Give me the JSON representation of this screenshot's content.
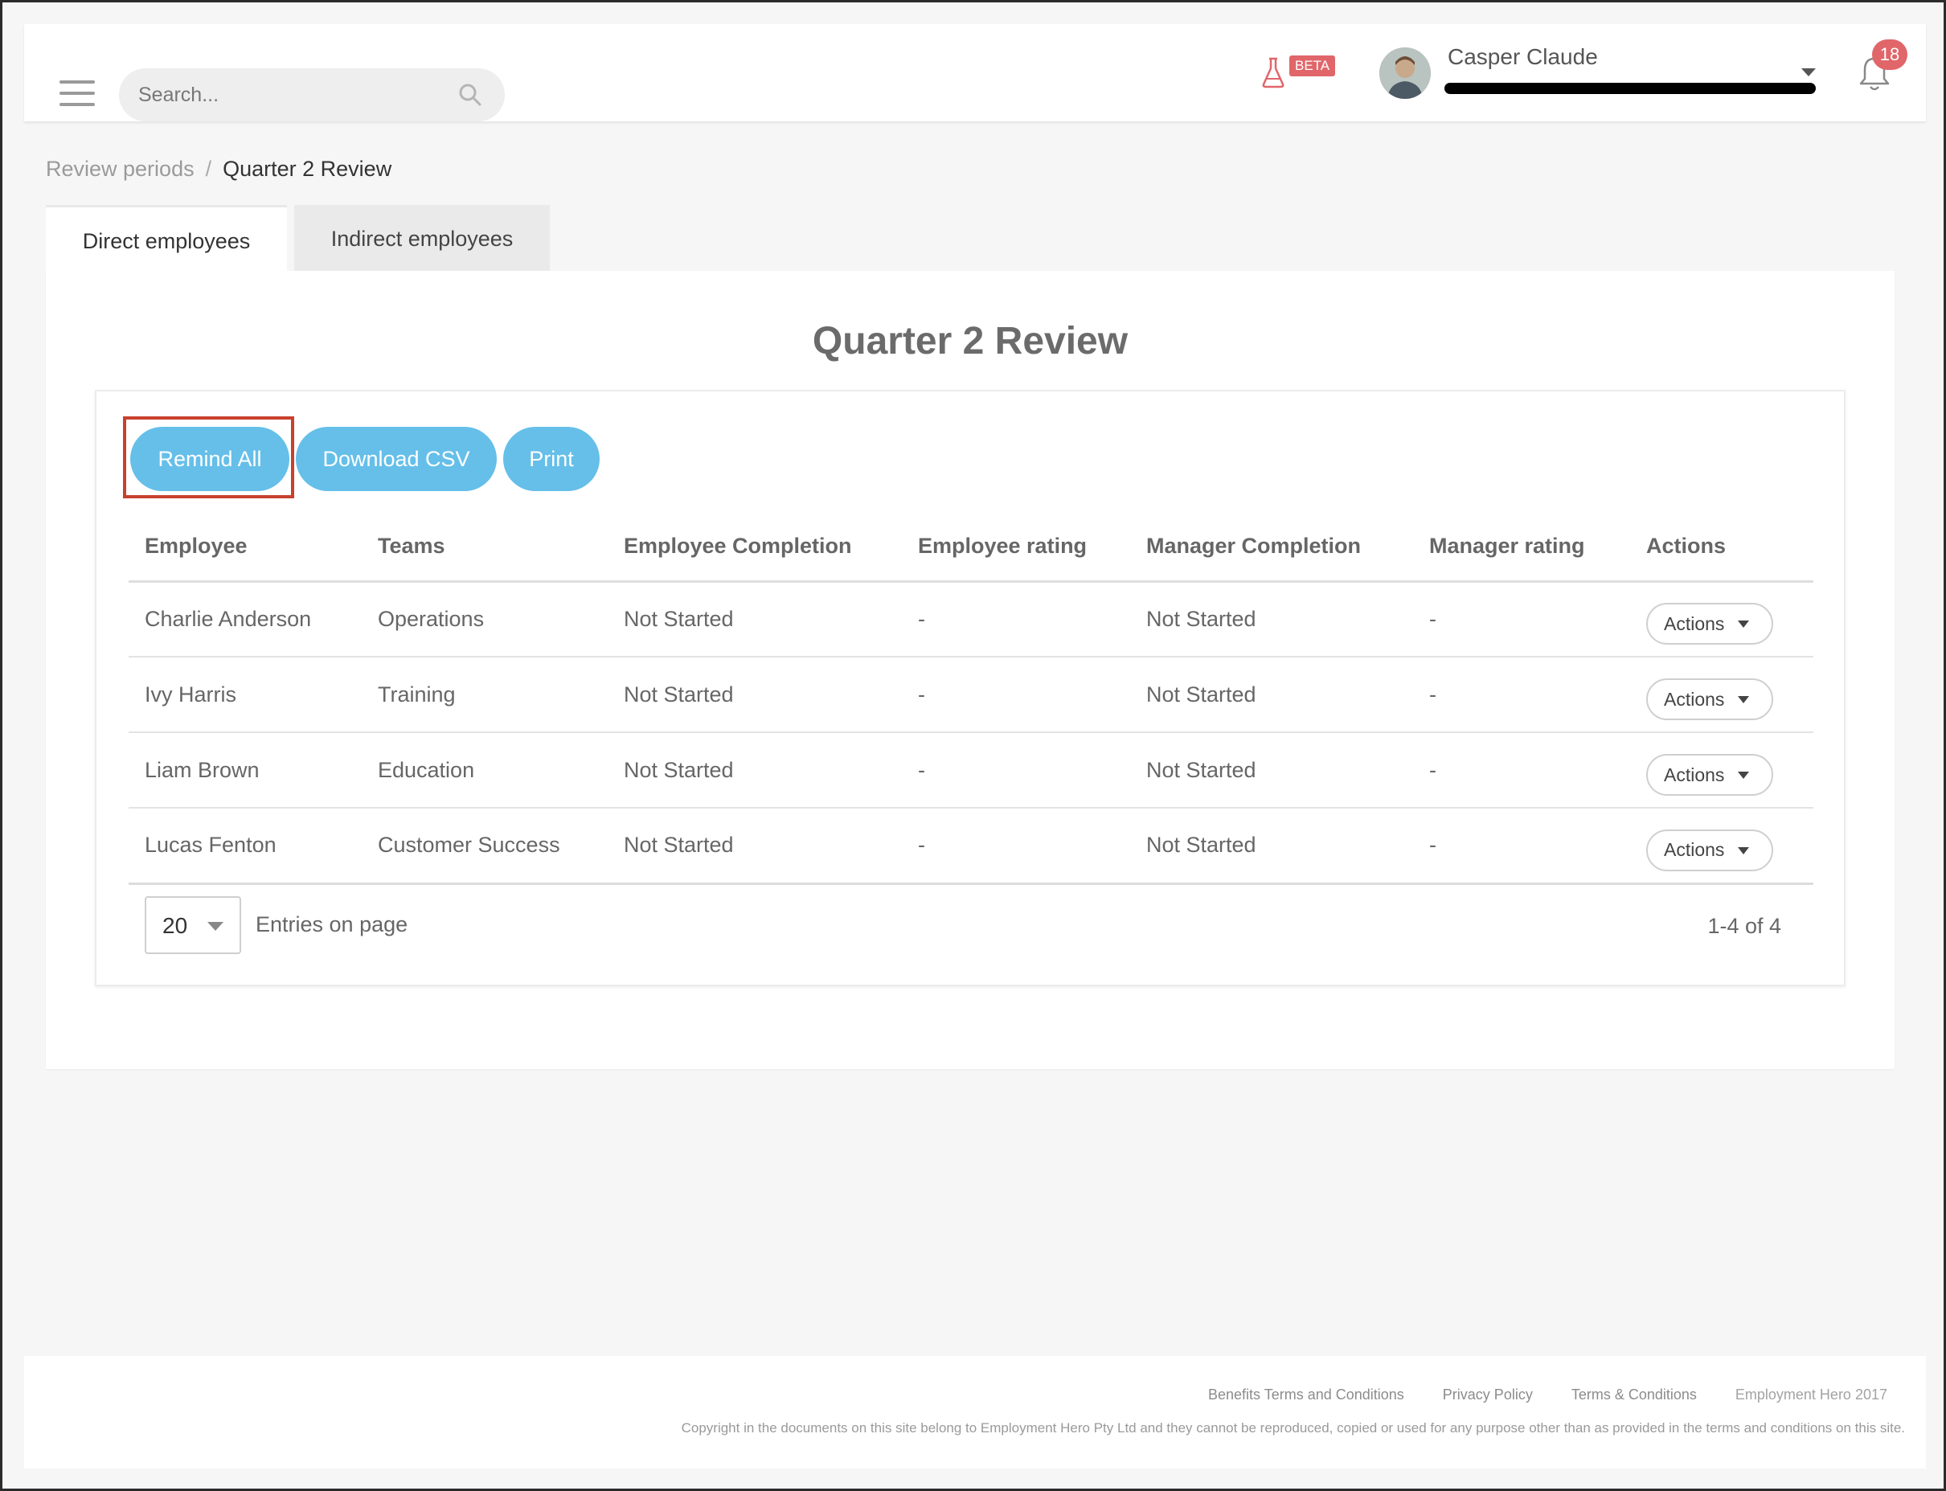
{
  "header": {
    "search_placeholder": "Search...",
    "beta_label": "BETA",
    "user_name": "Casper Claude",
    "notification_count": "18"
  },
  "breadcrumb": {
    "parent": "Review periods",
    "separator": "/",
    "current": "Quarter 2 Review"
  },
  "tabs": [
    {
      "label": "Direct employees",
      "active": true
    },
    {
      "label": "Indirect employees",
      "active": false
    }
  ],
  "main": {
    "title": "Quarter 2 Review",
    "buttons": {
      "remind_all": "Remind All",
      "download_csv": "Download CSV",
      "print": "Print"
    },
    "accent_color": "#65bfe9",
    "highlight_color": "#c8412d",
    "table": {
      "columns": [
        "Employee",
        "Teams",
        "Employee Completion",
        "Employee rating",
        "Manager Completion",
        "Manager rating",
        "Actions"
      ],
      "rows": [
        {
          "employee": "Charlie Anderson",
          "team": "Operations",
          "employee_completion": "Not Started",
          "employee_rating": "-",
          "manager_completion": "Not Started",
          "manager_rating": "-",
          "action": "Actions"
        },
        {
          "employee": "Ivy Harris",
          "team": "Training",
          "employee_completion": "Not Started",
          "employee_rating": "-",
          "manager_completion": "Not Started",
          "manager_rating": "-",
          "action": "Actions"
        },
        {
          "employee": "Liam Brown",
          "team": "Education",
          "employee_completion": "Not Started",
          "employee_rating": "-",
          "manager_completion": "Not Started",
          "manager_rating": "-",
          "action": "Actions"
        },
        {
          "employee": "Lucas Fenton",
          "team": "Customer Success",
          "employee_completion": "Not Started",
          "employee_rating": "-",
          "manager_completion": "Not Started",
          "manager_rating": "-",
          "action": "Actions"
        }
      ]
    },
    "pagination": {
      "page_size": "20",
      "entries_label": "Entries on page",
      "range": "1-4 of 4"
    }
  },
  "footer": {
    "links": [
      "Benefits Terms and Conditions",
      "Privacy Policy",
      "Terms & Conditions"
    ],
    "brand": "Employment Hero 2017",
    "copyright": "Copyright in the documents on this site belong to Employment Hero Pty Ltd and they cannot be reproduced, copied or used for any purpose other than as provided in the terms and conditions on this site."
  }
}
